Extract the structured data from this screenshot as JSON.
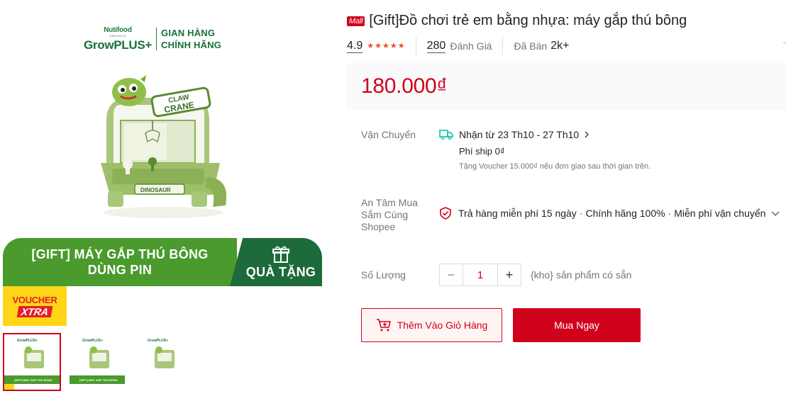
{
  "gallery": {
    "brand": {
      "nutri": "Nutifood",
      "sweden": "SWEDEN",
      "grow": "GrowPLUS+",
      "tag_line1": "GIAN HÀNG",
      "tag_line2": "CHÍNH HÃNG"
    },
    "toy": {
      "sign_top": "CLAW",
      "sign_bottom": "CRANE",
      "base_label": "DINOSAUR"
    },
    "banner": {
      "line1": "[GIFT] MÁY GẮP THÚ BÔNG",
      "line2": "DÙNG PIN",
      "gift_label": "QUÀ TẶNG"
    },
    "voucher": {
      "top": "VOUCHER",
      "bottom": "XTRA"
    },
    "thumbnails": [
      {
        "brand": "GrowPLUS+",
        "banner": "[GIFT] MÁY GẮP THÚ BÔNG"
      },
      {
        "brand": "GrowPLUS+",
        "banner": "[GIFT] MÁY GẮP THÚ BÔNG"
      },
      {
        "brand": "GrowPLUS+",
        "banner": ""
      }
    ]
  },
  "product": {
    "mall_badge": "Mall",
    "title": "[Gift]Đồ chơi trẻ em bằng nhựa: máy gắp thú bông",
    "rating": "4.9",
    "stars": 5,
    "reviews_count": "280",
    "reviews_label": "Đánh Giá",
    "sold_label": "Đã Bán",
    "sold_count": "2k+",
    "price": "180.000₫"
  },
  "shipping": {
    "label": "Vận Chuyển",
    "date": "Nhận từ 23 Th10 - 27 Th10",
    "fee": "Phí ship 0₫",
    "note": "Tặng Voucher 15.000₫ nếu đơn giao sau thời gian trên."
  },
  "guarantee": {
    "label_line1": "An Tâm Mua",
    "label_line2": "Sắm Cùng",
    "label_line3": "Shopee",
    "item1": "Trả hàng miễn phí 15 ngày",
    "item2": "Chính hãng 100%",
    "item3": "Miễn phí vận chuyển"
  },
  "quantity": {
    "label": "Số Lượng",
    "minus": "−",
    "value": "1",
    "plus": "+",
    "stock": "{kho} sản phẩm có sẵn"
  },
  "actions": {
    "add_to_cart": "Thêm Vào Giỏ Hàng",
    "buy_now": "Mua Ngay"
  },
  "colors": {
    "accent": "#d0011b",
    "banner_green": "#4a9a2e",
    "banner_dark": "#1d6a3a",
    "voucher_yellow": "#ffd617",
    "star": "#ee4d2d"
  },
  "icons": [
    "truck-icon",
    "chevron-right-icon",
    "shield-icon",
    "chevron-down-icon",
    "cart-icon",
    "gift-icon",
    "star-icon"
  ]
}
